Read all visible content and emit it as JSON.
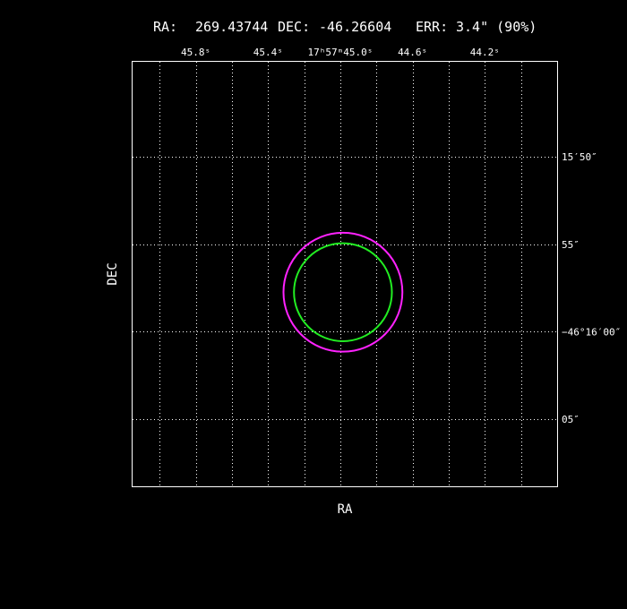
{
  "header": {
    "ra_label": "RA:",
    "ra_value": "269.43744",
    "dec_label": "DEC:",
    "dec_value": "-46.26604",
    "err_label": "ERR:",
    "err_value": "3.4\" (90%)"
  },
  "colors": {
    "background": "#000000",
    "frame": "#ffffff",
    "grid": "#ffffff",
    "outer_circle": "#ff22ff",
    "inner_circle": "#22ee22"
  },
  "chart_data": {
    "type": "scatter",
    "title": "RA: 269.43744  DEC: -46.26604  ERR: 3.4\" (90%)",
    "xlabel": "RA",
    "ylabel": "DEC",
    "grid": true,
    "x_axis_units": "seconds of time past 17h57m (decreasing to the right)",
    "y_axis_units": "arcseconds past -46°15' (increasing downward)",
    "xlim": [
      46.15,
      43.8
    ],
    "ylim": [
      44.56,
      68.84
    ],
    "x_grid_values": [
      46.0,
      45.8,
      45.6,
      45.4,
      45.2,
      45.0,
      44.8,
      44.6,
      44.4,
      44.2,
      44.0
    ],
    "y_grid_values": [
      50,
      55,
      60,
      65
    ],
    "x_tick_labels": [
      {
        "value": 45.8,
        "text": "45.8ˢ"
      },
      {
        "value": 45.4,
        "text": "45.4ˢ"
      },
      {
        "value": 45.0,
        "text": "17ʰ57ᵐ45.0ˢ"
      },
      {
        "value": 44.6,
        "text": "44.6ˢ"
      },
      {
        "value": 44.2,
        "text": "44.2ˢ"
      }
    ],
    "y_tick_labels": [
      {
        "value": 50,
        "text": "15′50″"
      },
      {
        "value": 55,
        "text": "55″"
      },
      {
        "value": 60,
        "text": "−46°16′00″"
      },
      {
        "value": 65,
        "text": "05″"
      }
    ],
    "source": {
      "ra_sec": 44.9856,
      "dec_arcsec": 57.74
    },
    "circles": [
      {
        "name": "outer",
        "radius_arcsec": 3.4,
        "color": "#ff22ff"
      },
      {
        "name": "inner",
        "radius_arcsec": 2.8,
        "color": "#22ee22"
      }
    ]
  }
}
